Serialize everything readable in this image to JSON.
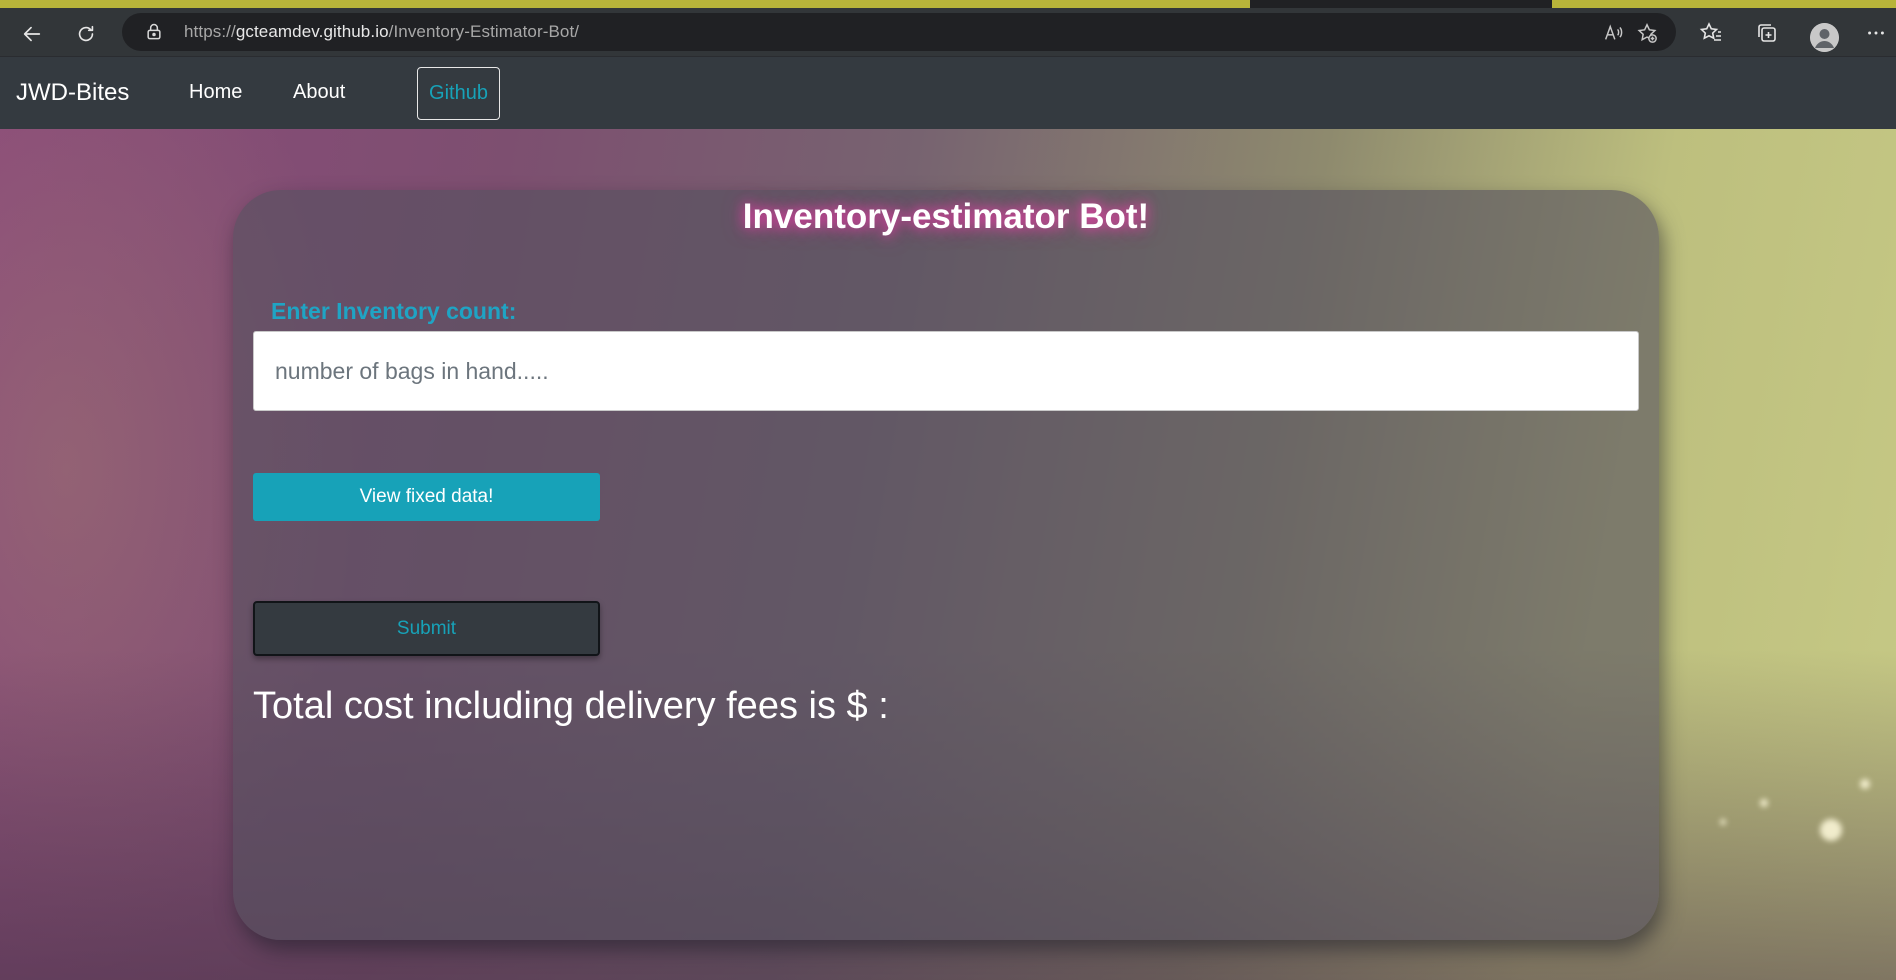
{
  "browser": {
    "url_scheme": "https://",
    "url_host": "gcteamdev.github.io",
    "url_path": "/Inventory-Estimator-Bot/"
  },
  "navbar": {
    "brand": "JWD-Bites",
    "links": [
      {
        "label": "Home"
      },
      {
        "label": "About"
      }
    ],
    "github_label": "Github"
  },
  "card": {
    "title": "Inventory-estimator Bot!",
    "input_label": "Enter Inventory count:",
    "input_placeholder": "number of bags in hand.....",
    "input_value": "",
    "view_button_label": "View fixed data!",
    "submit_button_label": "Submit",
    "total_text": "Total cost including delivery fees is $ :"
  },
  "colors": {
    "accent": "#17a2b8",
    "navbar_bg": "#343a40",
    "title_glow": "#ff3cb4"
  }
}
